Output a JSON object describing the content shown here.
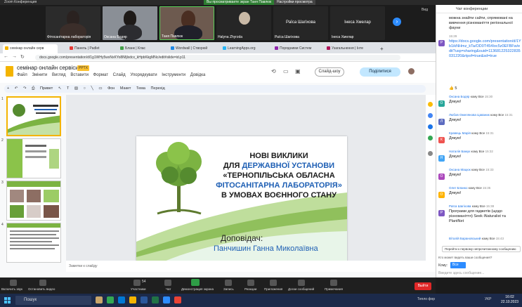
{
  "zoom": {
    "title": "Zoom Конференция",
    "sharing_notice": "Вы просматриваете экран Таня Павлюк",
    "view_options": "Настройки просмотра",
    "view": "Вид"
  },
  "video_tiles": [
    {
      "name": "Фітосанітарна лабораторія"
    },
    {
      "name": "Оксана Бодяр"
    },
    {
      "name": "Таня Павлюк"
    },
    {
      "name": "Halyna Zhyrzda"
    },
    {
      "name": "Раїса Шагіхова"
    },
    {
      "name": "Інеса Хмелар"
    }
  ],
  "browser": {
    "tabs": [
      {
        "label": "семінар онлайн серв",
        "color": "#f4b400"
      },
      {
        "label": "Панель | Padlet",
        "color": "#e53935"
      },
      {
        "label": "Бланк | Клас",
        "color": "#43a047"
      },
      {
        "label": "Wordwall | Створюй",
        "color": "#1e88e5"
      },
      {
        "label": "LearningApps.org",
        "color": "#29b6f6"
      },
      {
        "label": "Порядними Систем",
        "color": "#8e24aa"
      },
      {
        "label": "Узагальнення | Інте",
        "color": "#ad1457"
      }
    ],
    "url": "docs.google.com/presentation/d/1g1WHy5wxNxKYo8lMjlxdcx_kHpbKkgMNc/edit#slide=id.p11"
  },
  "slides_app": {
    "title": "семінар онлайн сервіси",
    "badge": "PPTX",
    "menus": [
      "Файл",
      "Змінити",
      "Вигляд",
      "Вставити",
      "Формат",
      "Слайд",
      "Упорядкувати",
      "Інструменти",
      "Довідка"
    ],
    "slideshow": "Слайд-шоу",
    "share": "Поділитися",
    "toolbar": [
      "Привет",
      "Фон",
      "Макет",
      "Тема",
      "Перехід"
    ],
    "notes_placeholder": "Заметки к слайду",
    "thumbnails": [
      "1",
      "2",
      "3",
      "4"
    ]
  },
  "slide": {
    "title_line1": "НОВІ ВИКЛИКИ",
    "title_line2_a": "ДЛЯ",
    "title_line2_b": "ДЕРЖАВНОЇ УСТАНОВИ",
    "title_line3": "«ТЕРНОПІЛЬСЬКА ОБЛАСНА",
    "title_line4": "ФІТОСАНІТАРНА ЛАБОРАТОРІЯ»",
    "title_line5": "В УМОВАХ ВОЄННОГО СТАНУ",
    "presenter_label": "Доповідач:",
    "presenter_name": "Панчишин Ганна Миколаївна"
  },
  "chat": {
    "header": "Чат конференции",
    "messages": [
      {
        "from": "",
        "to": "",
        "time": "",
        "text": "можна знайти сайти, спрямовані на вивчення різноманіття регіональної фауни"
      },
      {
        "from": "",
        "to": "",
        "time": "15:29",
        "text": "https://docs.google.com/presentation/d/1Yb1ikNHmz_kTa/OD0T454Ioc5z0EFBFw/edit?usp=sharing&ouid=113681225322835031220&rtpof=true&sd=true"
      },
      {
        "from": "",
        "to": "",
        "time": "",
        "text": "👍 5"
      },
      {
        "from": "Оксана Бодяр",
        "to": "кому Все",
        "time": "15:30",
        "text": "Дякую!"
      },
      {
        "from": "Любов Омелянова Цаваник",
        "to": "кому Все",
        "time": "15:31",
        "text": "Дякую!"
      },
      {
        "from": "Кравець Марія",
        "to": "кому Все",
        "time": "15:31",
        "text": "Дякую!"
      },
      {
        "from": "Наталія Бажук",
        "to": "кому Все",
        "time": "15:32",
        "text": "Дякую!"
      },
      {
        "from": "Оксана Мацюк",
        "to": "кому Все",
        "time": "15:33",
        "text": "Дякую!"
      },
      {
        "from": "Олег Бланко",
        "to": "кому Все",
        "time": "15:35",
        "text": "Дякую!"
      },
      {
        "from": "Раїса Шагіхова",
        "to": "кому Все",
        "time": "15:38",
        "text": "Програми для гаджетів (щодо різноманіття) Seek iNaturalist та PlantNet"
      },
      {
        "from": "Віталій Барановський",
        "to": "кому Все",
        "time": "15:43",
        "text": ""
      }
    ],
    "jump_to_unread": "Перейти к первому непрочитанному сообщению",
    "who_sees": "Кто может видеть ваши сообщения?",
    "to_label": "Кому:",
    "to_value": "Все",
    "input_placeholder": "Введите здесь сообщение..."
  },
  "zoom_toolbar": {
    "mute": "Включить звук",
    "video": "Остановить видео",
    "participants": "Участники",
    "participants_count": "54",
    "chat": "Чат",
    "share": "Демонстрация экрана",
    "record": "Запись",
    "reactions": "Реакции",
    "apps": "Приложения",
    "whiteboard": "Доски сообщений",
    "notes": "Примечания",
    "leave": "Выйти"
  },
  "taskbar": {
    "search": "Пошук",
    "weather": "Тепло фор",
    "lang": "УКР",
    "time": "16:02",
    "date": "22.10.2023"
  }
}
